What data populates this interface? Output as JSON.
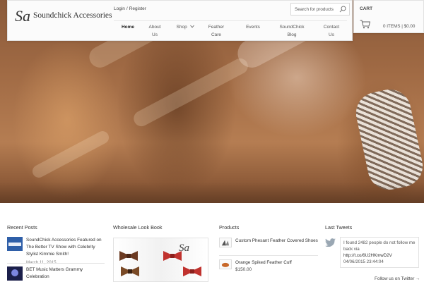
{
  "header": {
    "logo_mark": "Sa",
    "brand": "Soundchick Accessories",
    "login": "Login",
    "register": "Register",
    "login_sep": "/",
    "search_placeholder": "Search for products",
    "nav": [
      "Home",
      "About Us",
      "Shop",
      "Feather Care",
      "Events",
      "SoundChick Blog",
      "Contact Us"
    ],
    "active_nav": "Home"
  },
  "cart": {
    "title": "CART",
    "summary": "0 ITEMS | $0.00"
  },
  "recent_posts": {
    "title": "Recent Posts",
    "posts": [
      {
        "title": "SoundChick Accessories Featured on The Better TV Show with Celebrity Stylist Kimmie Smith!",
        "date": "March 11, 2015"
      },
      {
        "title": "BET Music Matters Grammy Celebration",
        "date": ""
      }
    ]
  },
  "lookbook": {
    "title": "Wholesale Look Book",
    "mark": "Sa"
  },
  "products": {
    "title": "Products",
    "items": [
      {
        "name": "Custom Phesant Feather Covered Shoes",
        "price": ""
      },
      {
        "name": "Orange Spiked Feather Cuff",
        "price": "$150.00"
      }
    ]
  },
  "tweets": {
    "title": "Last Tweets",
    "text": "I found 2482 people do not follow me back via",
    "link": "http://t.co/6U2HKmwD2V",
    "time": "04/06/2015 23:44:04",
    "follow": "Follow us on Twitter →"
  },
  "colors": {
    "header_bg": "#fbfbfb",
    "text": "#333333",
    "bow_red": "#c0322e",
    "bow_leopard": "#6b3a22"
  }
}
